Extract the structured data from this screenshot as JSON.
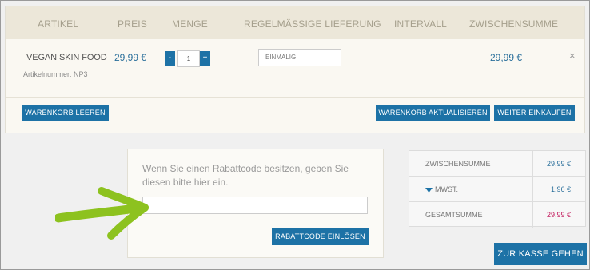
{
  "cart": {
    "headers": {
      "article": "ARTIKEL",
      "price": "PREIS",
      "quantity": "MENGE",
      "delivery": "REGELMÄSSIGE LIEFERUNG",
      "interval": "INTERVALL",
      "subtotal": "ZWISCHENSUMME"
    },
    "item": {
      "name": "VEGAN SKIN FOOD",
      "article_number": "Artikelnummer: NP3",
      "price": "29,99 €",
      "quantity": "1",
      "minus_label": "-",
      "plus_label": "+",
      "interval": "EINMALIG",
      "subtotal": "29,99 €",
      "remove": "×"
    },
    "clear_label": "WARENKORB LEEREN",
    "update_label": "WARENKORB AKTUALISIEREN",
    "continue_label": "WEITER EINKAUFEN"
  },
  "coupon": {
    "text": "Wenn Sie einen Rabattcode besitzen, geben Sie diesen bitte hier ein.",
    "value": "",
    "redeem_label": "RABATTCODE EINLÖSEN"
  },
  "totals": {
    "subtotal_label": "ZWISCHENSUMME",
    "subtotal_value": "29,99 €",
    "tax_label": "MWST.",
    "tax_value": "1,96 €",
    "total_label": "GESAMTSUMME",
    "total_value": "29,99 €"
  },
  "checkout_label": "ZUR KASSE GEHEN",
  "colors": {
    "accent": "#1d72a6",
    "total_red": "#c2185b",
    "arrow_green": "#8dc21f"
  },
  "icons": [
    "remove-icon",
    "caret-down-icon",
    "arrow-annotation-icon"
  ]
}
